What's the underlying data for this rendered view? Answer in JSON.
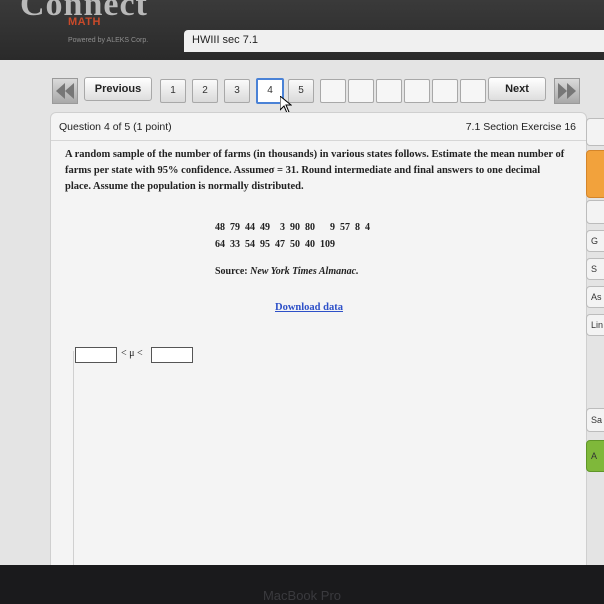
{
  "header": {
    "logo": "Connect",
    "brand": "MATH",
    "powered_by": "Powered by ALEKS Corp.",
    "tab": "HWIII sec 7.1"
  },
  "nav": {
    "previous": "Previous",
    "next": "Next",
    "pages": [
      "1",
      "2",
      "3",
      "4",
      "5"
    ],
    "current_page": "4"
  },
  "question": {
    "number_text": "Question 4 of 5 (1 point)",
    "section": "7.1 Section Exercise 16",
    "problem": "A random sample of the number of farms (in thousands) in various states follows. Estimate the mean number of farms per state with 95% confidence. Assumeσ = 31. Round intermediate and final answers to one decimal place. Assume the population is normally distributed.",
    "data_row1": "48  79  44  49    3  90  80      9  57  8  4",
    "data_row2": "64  33  54  95  47  50  40  109",
    "source_label": "Source:",
    "source_name": "New York Times Almanac.",
    "download": "Download data",
    "inequality": "< μ <",
    "lower_value": "",
    "upper_value": ""
  },
  "side_buttons": [
    "",
    "",
    "",
    "G",
    "S",
    "As",
    "Lin",
    "Sa",
    "A"
  ],
  "device": "MacBook Pro",
  "colors": {
    "accent_blue": "#4a82d6",
    "orange": "#f2a23c",
    "green": "#7fb83a",
    "link": "#2d50c8"
  }
}
